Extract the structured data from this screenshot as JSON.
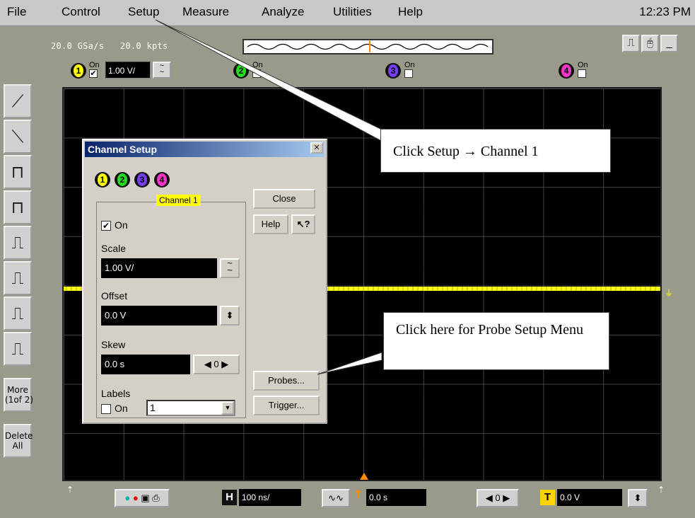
{
  "menubar": {
    "items": [
      "File",
      "Control",
      "Setup",
      "Measure",
      "Analyze",
      "Utilities",
      "Help"
    ],
    "clock": "12:23 PM"
  },
  "status": {
    "sample_rate": "20.0 GSa/s",
    "memory": "20.0 kpts"
  },
  "channels": [
    {
      "num": "1",
      "on_label": "On",
      "on": true,
      "scale": "1.00 V/",
      "color": "#ffff00"
    },
    {
      "num": "2",
      "on_label": "On",
      "on": false,
      "color": "#22dd22"
    },
    {
      "num": "3",
      "on_label": "On",
      "on": false,
      "color": "#7a3cff"
    },
    {
      "num": "4",
      "on_label": "On",
      "on": false,
      "color": "#ff33cc"
    }
  ],
  "tools": {
    "more_label": "More\n(1of 2)",
    "delete_label": "Delete\nAll"
  },
  "dialog": {
    "title": "Channel Setup",
    "group_title": "Channel 1",
    "on_label": "On",
    "on_checked": true,
    "scale_label": "Scale",
    "scale_value": "1.00 V/",
    "offset_label": "Offset",
    "offset_value": "0.0 V",
    "skew_label": "Skew",
    "skew_value": "0.0 s",
    "skew_step": "0",
    "labels_label": "Labels",
    "labels_on_label": "On",
    "labels_on_checked": false,
    "labels_value": "1",
    "close_label": "Close",
    "help_label": "Help",
    "probes_label": "Probes...",
    "trigger_label": "Trigger..."
  },
  "bottombar": {
    "h_badge": "H",
    "timebase": "100 ns/",
    "delay": "0.0 s",
    "delay_step": "0",
    "t_badge": "T",
    "trigger_level": "0.0 V"
  },
  "callouts": {
    "setup": "Click Setup → Channel 1",
    "probes": "Click here for Probe Setup Menu"
  }
}
